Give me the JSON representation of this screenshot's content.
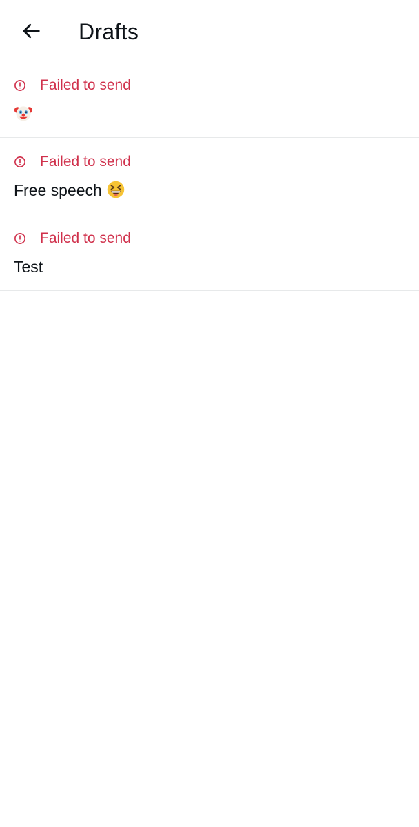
{
  "header": {
    "title": "Drafts",
    "back_icon": "arrow-left-icon"
  },
  "colors": {
    "error": "#d0314c",
    "divider": "#e7e9ea",
    "text": "#0f1419"
  },
  "drafts": [
    {
      "status": "Failed to send",
      "status_icon": "alert-circle-icon",
      "text": "",
      "emoji": "clown-face-emoji"
    },
    {
      "status": "Failed to send",
      "status_icon": "alert-circle-icon",
      "text": "Free speech ",
      "emoji": "grinning-squinting-face-emoji"
    },
    {
      "status": "Failed to send",
      "status_icon": "alert-circle-icon",
      "text": "Test",
      "emoji": ""
    }
  ]
}
